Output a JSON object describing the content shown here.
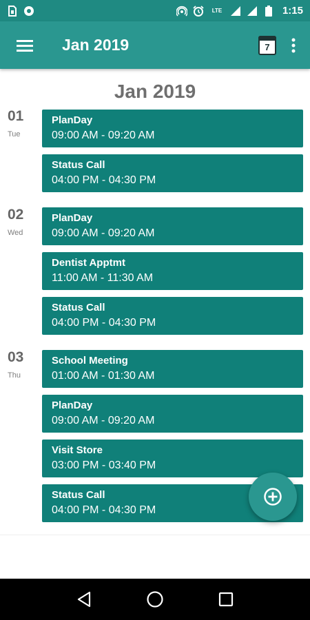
{
  "status_bar": {
    "time": "1:15",
    "network_label": "LTE",
    "icons": [
      "sim-icon",
      "sync-icon",
      "hotspot-icon",
      "alarm-icon",
      "lte-call-icon",
      "signal-icon",
      "signal-icon",
      "battery-icon"
    ]
  },
  "app_bar": {
    "title": "Jan 2019",
    "today_number": "7"
  },
  "agenda": {
    "month_header": "Jan 2019",
    "days": [
      {
        "day": "01",
        "dow": "Tue",
        "events": [
          {
            "title": "PlanDay",
            "time": "09:00 AM - 09:20 AM"
          },
          {
            "title": "Status Call",
            "time": "04:00 PM - 04:30 PM"
          }
        ]
      },
      {
        "day": "02",
        "dow": "Wed",
        "events": [
          {
            "title": "PlanDay",
            "time": "09:00 AM - 09:20 AM"
          },
          {
            "title": "Dentist Apptmt",
            "time": "11:00 AM - 11:30 AM"
          },
          {
            "title": "Status Call",
            "time": "04:00 PM - 04:30 PM"
          }
        ]
      },
      {
        "day": "03",
        "dow": "Thu",
        "events": [
          {
            "title": "School Meeting",
            "time": "01:00 AM - 01:30 AM"
          },
          {
            "title": "PlanDay",
            "time": "09:00 AM - 09:20 AM"
          },
          {
            "title": "Visit Store",
            "time": "03:00 PM - 03:40 PM"
          },
          {
            "title": "Status Call",
            "time": "04:00 PM - 04:30 PM"
          }
        ]
      }
    ]
  },
  "colors": {
    "status_bar": "#1f8a82",
    "app_bar": "#2a9790",
    "event_card": "#108079",
    "fab": "#2a9790"
  }
}
